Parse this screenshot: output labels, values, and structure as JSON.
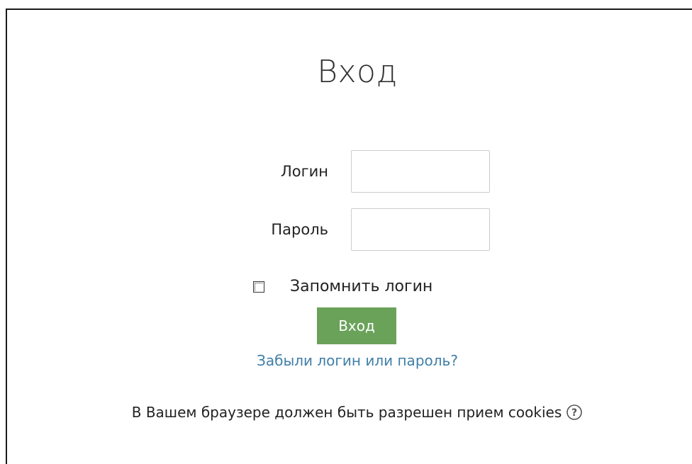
{
  "page": {
    "title": "Вход"
  },
  "form": {
    "username": {
      "label": "Логин",
      "value": "",
      "placeholder": ""
    },
    "password": {
      "label": "Пароль",
      "value": "",
      "placeholder": ""
    },
    "remember": {
      "label": "Запомнить логин",
      "checked": false
    },
    "submit_label": "Вход",
    "forgot_link": "Забыли логин или пароль?"
  },
  "cookies_notice": {
    "text": "В Вашем браузере должен быть разрешен прием cookies",
    "help_icon": "question-circle-icon"
  },
  "colors": {
    "button_bg": "#6aa25a",
    "link": "#3f7fa8"
  }
}
